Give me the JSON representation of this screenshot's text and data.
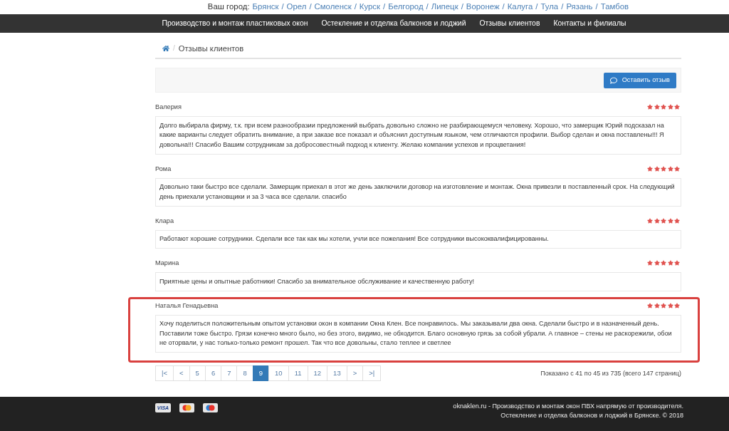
{
  "city_bar": {
    "label": "Ваш город:",
    "separator": "/",
    "cities": [
      "Брянск",
      "Орел",
      "Смоленск",
      "Курск",
      "Белгород",
      "Липецк",
      "Воронеж",
      "Калуга",
      "Тула",
      "Рязань",
      "Тамбов"
    ]
  },
  "nav": {
    "items": [
      "Производство и монтаж пластиковых окон",
      "Остекление и отделка балконов и лоджий",
      "Отзывы клиентов",
      "Контакты и филиалы"
    ]
  },
  "breadcrumb": {
    "separator": "/",
    "current": "Отзывы клиентов"
  },
  "toolbar": {
    "button": "Оставить отзыв"
  },
  "reviews": [
    {
      "name": "Валерия",
      "stars": 5,
      "highlighted": false,
      "text": "Долго выбирала фирму, т.к. при всем разнообразии предложений выбрать довольно сложно не разбирающемуся человеку. Хорошо, что замерщик Юрий подсказал на какие варианты следует обратить внимание, а при заказе все показал и объяснил доступным языком, чем отличаются профили. Выбор сделан и окна поставлены!!! Я довольна!!! Спасибо Вашим сотрудникам за добросовестный подход к клиенту. Желаю компании успехов и процветания!"
    },
    {
      "name": "Рома",
      "stars": 5,
      "highlighted": false,
      "text": "Довольно таки быстро все сделали. Замерщик приехал в этот же день заключили договор на изготовление и монтаж. Окна привезли в поставленный срок. На следующий день приехали установщики и за 3 часа все сделали. спасибо"
    },
    {
      "name": "Клара",
      "stars": 5,
      "highlighted": false,
      "text": "Работают хорошие сотрудники. Сделали все так как мы хотели, учли все пожелания! Все сотрудники высококвалифицированны."
    },
    {
      "name": "Марина",
      "stars": 5,
      "highlighted": false,
      "text": "Приятные цены и опытные работники! Спасибо за внимательное обслуживание и качественную работу!"
    },
    {
      "name": "Наталья Генадьевна",
      "stars": 5,
      "highlighted": true,
      "text": "Хочу поделиться положительным опытом установки окон в компании Окна Клен. Все понравилось. Мы заказывали два окна. Сделали быстро и в назначенный день. Поставили тоже быстро. Грязи конечно много было, но без этого, видимо, не обходится. Благо основную грязь за собой убрали. А главное – стены не раскорежили, обои не оторвали, у нас только-только ремонт прошел. Так что все довольны, стало теплее и светлее"
    }
  ],
  "pagination": {
    "pages": [
      {
        "label": "|<",
        "selected": false
      },
      {
        "label": "<",
        "selected": false
      },
      {
        "label": "5",
        "selected": false
      },
      {
        "label": "6",
        "selected": false
      },
      {
        "label": "7",
        "selected": false
      },
      {
        "label": "8",
        "selected": false
      },
      {
        "label": "9",
        "selected": true
      },
      {
        "label": "10",
        "selected": false
      },
      {
        "label": "11",
        "selected": false
      },
      {
        "label": "12",
        "selected": false
      },
      {
        "label": "13",
        "selected": false
      },
      {
        "label": ">",
        "selected": false
      },
      {
        "label": ">|",
        "selected": false
      }
    ],
    "summary": "Показано с 41 по 45 из 735 (всего 147 страниц)"
  },
  "footer": {
    "payment_methods": [
      {
        "kind": "visa",
        "label": "VISA"
      },
      {
        "kind": "mastercard"
      },
      {
        "kind": "maestro"
      }
    ],
    "lines": [
      "oknaklen.ru - Производство и монтаж окон ПВХ напрямую от производителя.",
      "Остекление и отделка балконов и лоджий в Брянске. © 2018"
    ]
  }
}
